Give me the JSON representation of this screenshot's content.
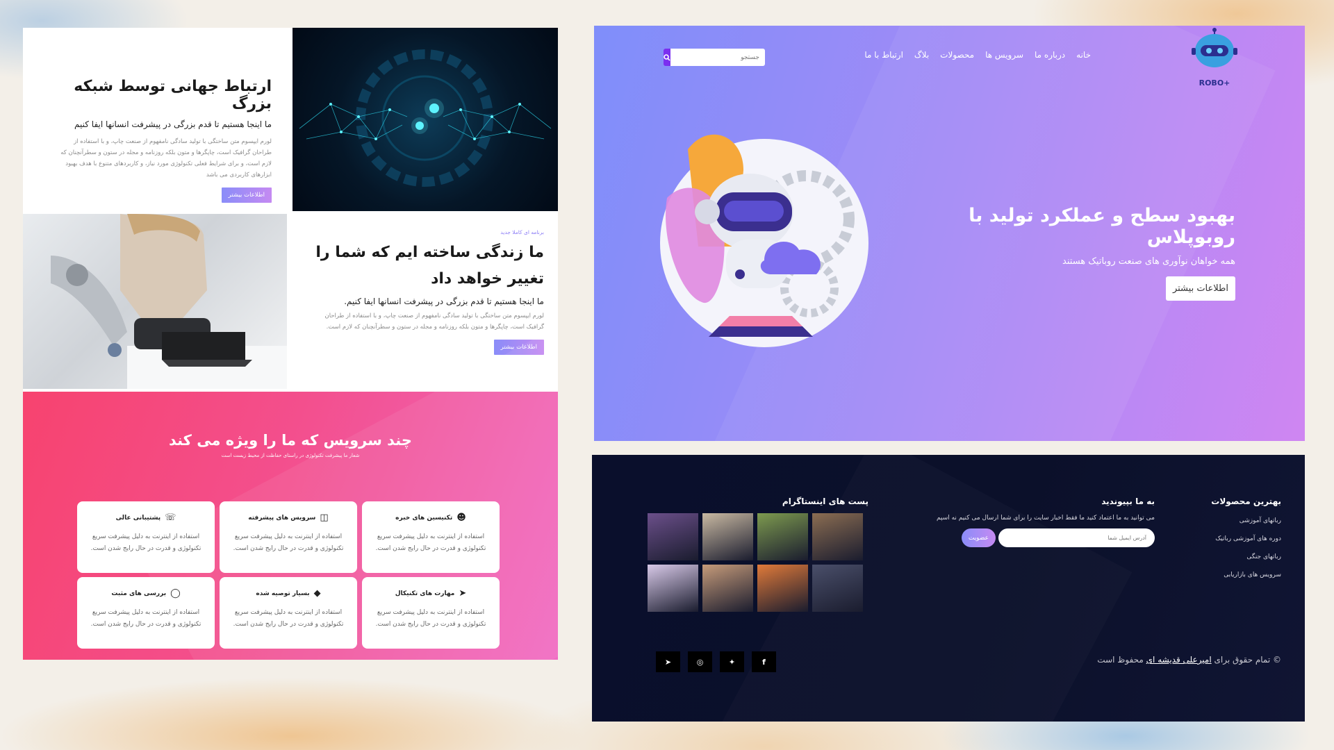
{
  "about": {
    "block1": {
      "title": "ارتباط جهانی توسط شبکه بزرگ",
      "subtitle": "ما اینجا هستیم تا قدم بزرگی در پیشرفت انسانها ایفا کنیم",
      "body": "لورم ایپسوم متن ساختگی با تولید سادگی نامفهوم از صنعت چاپ، و با استفاده از طراحان گرافیک است، چاپگرها و متون بلکه روزنامه و مجله در ستون و سطرآنچنان که لازم است، و برای شرایط فعلی تکنولوژی مورد نیاز، و کاربردهای متنوع با هدف بهبود ابزارهای کاربردی می باشد",
      "button": "اطلاعات بیشتر"
    },
    "block2": {
      "kicker": "برنامه ای کاملا جدید",
      "title": "ما زندگی ساخته ایم که شما را تغییر خواهد داد",
      "subtitle": "ما اینجا هستیم تا قدم بزرگی در پیشرفت انسانها ایفا کنیم.",
      "body": "لورم ایپسوم متن ساختگی با تولید سادگی نامفهوم از صنعت چاپ، و با استفاده از طراحان گرافیک است، چاپگرها و متون بلکه روزنامه و مجله در ستون و سطرآنچنان که لازم است.",
      "button": "اطلاعات بیشتر"
    }
  },
  "services": {
    "title": "چند سرویس که ما را ویژه می کند",
    "tagline": "شعار ما پیشرفت تکنولوژی در راستای حفاظت از محیط زیست است",
    "cards": [
      {
        "title": "تکنیسین های خبره",
        "icon": "user-icon",
        "desc": "استفاده از اینترنت به دلیل پیشرفت سریع تکنولوژی و قدرت در حال رایج شدن است."
      },
      {
        "title": "سرویس های پیشرفته",
        "icon": "server-icon",
        "desc": "استفاده از اینترنت به دلیل پیشرفت سریع تکنولوژی و قدرت در حال رایج شدن است."
      },
      {
        "title": "پشتیبانی عالی",
        "icon": "phone-icon",
        "desc": "استفاده از اینترنت به دلیل پیشرفت سریع تکنولوژی و قدرت در حال رایج شدن است."
      },
      {
        "title": "مهارت های تکنیکال",
        "icon": "rocket-icon",
        "desc": "استفاده از اینترنت به دلیل پیشرفت سریع تکنولوژی و قدرت در حال رایج شدن است."
      },
      {
        "title": "بسیار توصیه شده",
        "icon": "diamond-icon",
        "desc": "استفاده از اینترنت به دلیل پیشرفت سریع تکنولوژی و قدرت در حال رایج شدن است."
      },
      {
        "title": "بررسی های مثبت",
        "icon": "comment-icon",
        "desc": "استفاده از اینترنت به دلیل پیشرفت سریع تکنولوژی و قدرت در حال رایج شدن است."
      }
    ]
  },
  "hero": {
    "logo_text": "ROBO+",
    "nav": [
      "خانه",
      "درباره ما",
      "سرویس ها",
      "محصولات",
      "بلاگ",
      "ارتباط با ما"
    ],
    "search_placeholder": "جستجو",
    "title": "بهبود سطح و عملکرد تولید با روبوپلاس",
    "subtitle": "همه خواهان نوآوری های صنعت روباتیک هستند",
    "button": "اطلاعات بیشتر"
  },
  "footer": {
    "products": {
      "title": "بهترین محصولات",
      "items": [
        "رباتهای آموزشی",
        "دوره های آموزشی رباتیک",
        "رباتهای جنگی",
        "سرویس های بازاریابی"
      ]
    },
    "join": {
      "title": "به ما بپیوندید",
      "desc": "می توانید به ما اعتماد کنید ما فقط اخبار سایت را برای شما ارسال می کنیم نه اسپم",
      "email_placeholder": "آدرس ایمیل شما",
      "button": "عضویت"
    },
    "instagram": {
      "title": "پست های اینستاگرام",
      "thumb_colors": [
        "#6b4f8a",
        "#c9b9a2",
        "#7d9a4f",
        "#8b6d52",
        "#d8c9e8",
        "#c69b7a",
        "#e07a3a",
        "#4a4f6a"
      ]
    },
    "copyright": {
      "prefix": "© تمام حقوق برای",
      "author": "امیرعلی قدیشه ای",
      "suffix": "محفوظ است"
    },
    "socials": [
      "facebook-icon",
      "twitter-icon",
      "dribbble-icon",
      "telegram-icon"
    ]
  },
  "colors": {
    "hero_gradient_start": "#7f8efa",
    "hero_gradient_end": "#cf86f2",
    "services_gradient_start": "#f7436f",
    "services_gradient_end": "#f06bc2",
    "footer_bg": "#0a0f2c",
    "accent_purple": "#7b2ff0"
  }
}
